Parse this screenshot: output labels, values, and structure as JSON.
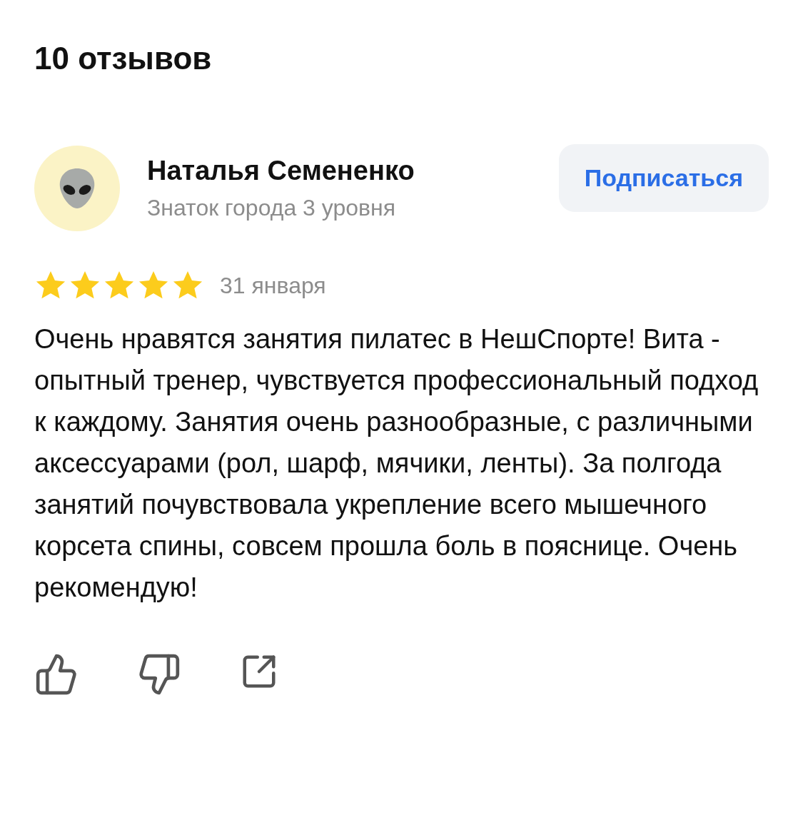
{
  "title": "10 отзывов",
  "review": {
    "author": "Наталья Семененко",
    "subtitle": "Знаток города 3 уровня",
    "subscribe_button": "Подписаться",
    "stars": 5,
    "date": "31 января",
    "text": "Очень нравятся занятия пилатес в НешСпорте! Вита - опытный тренер, чувствуется профессиональный подход к каждому. Занятия очень разнообразные, с различными аксессуарами (рол, шарф, мячики, ленты). За полгода занятий почувствовала укрепление всего мышечного корсета спины, совсем прошла боль в пояснице. Очень рекомендую!"
  }
}
